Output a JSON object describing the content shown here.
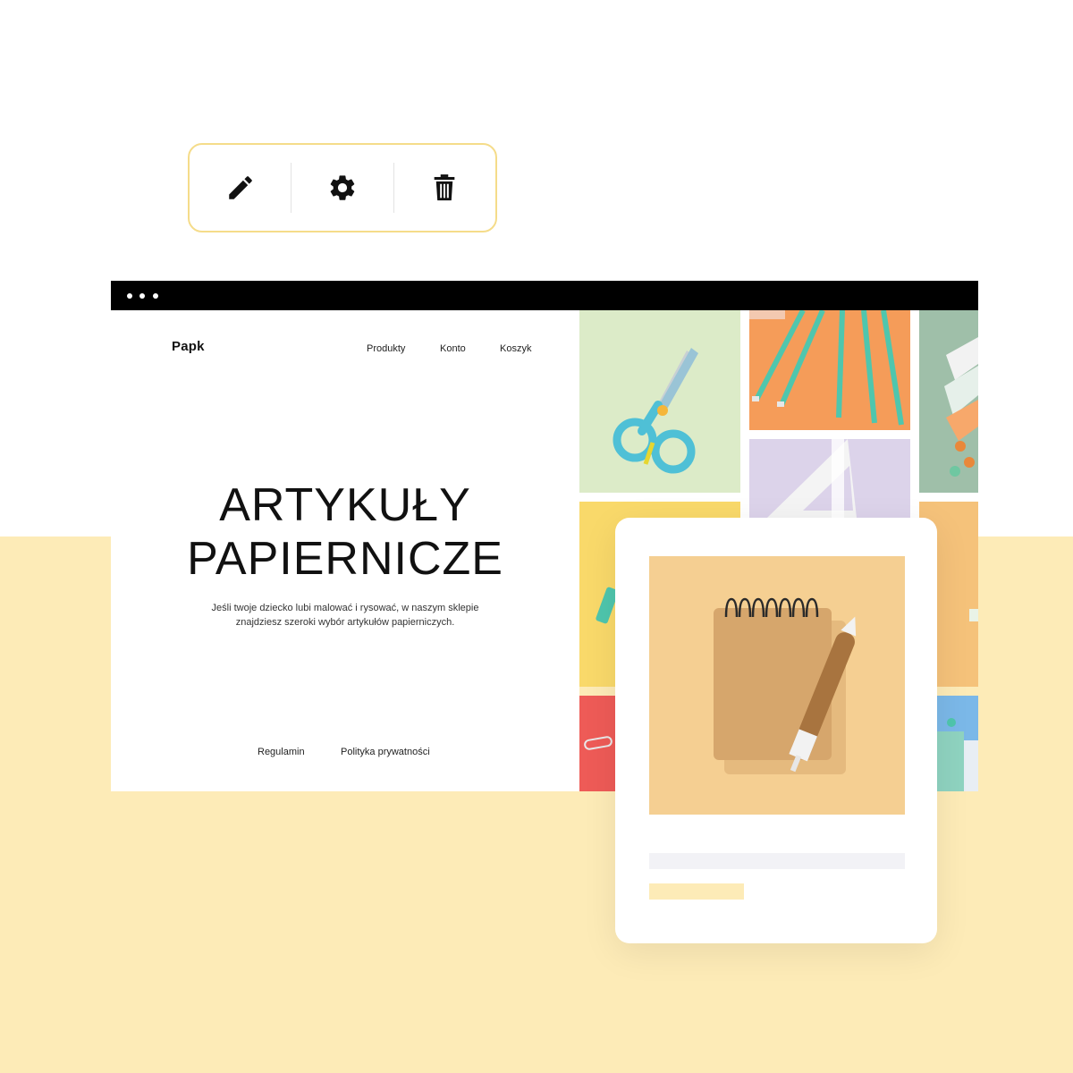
{
  "toolbar": {
    "icons": [
      "pencil-icon",
      "gear-icon",
      "trash-icon"
    ]
  },
  "window": {
    "dots": 3
  },
  "site": {
    "logo": "Papk",
    "nav": [
      "Produkty",
      "Konto",
      "Koszyk"
    ],
    "hero_line1": "ARTYKUŁY",
    "hero_line2": "PAPIERNICZE",
    "description": "Jeśli twoje dziecko lubi malować i rysować, w naszym sklepie znajdziesz szeroki wybór artykułów papierniczych.",
    "footer_links": [
      "Regulamin",
      "Polityka prywatności"
    ]
  },
  "gallery": [
    {
      "subject": "scissors",
      "color": "#dcebc8"
    },
    {
      "subject": "pencils",
      "color": "#f59c59"
    },
    {
      "subject": "stationery",
      "color": "#9fbfa9"
    },
    {
      "subject": "triangle-ruler",
      "color": "#dcd3ea"
    },
    {
      "subject": "yellow",
      "color": "#f9d96a"
    },
    {
      "subject": "orange",
      "color": "#f5c27a"
    },
    {
      "subject": "paperclip",
      "color": "#ee5b57"
    },
    {
      "subject": "blue-notebooks",
      "color": "#7bb8e8"
    }
  ],
  "card": {
    "image": "notebook-and-pen",
    "image_color": "#f5cf92"
  },
  "colors": {
    "accent_yellow": "#fdebb7",
    "toolbar_border": "#f5dc8a"
  }
}
